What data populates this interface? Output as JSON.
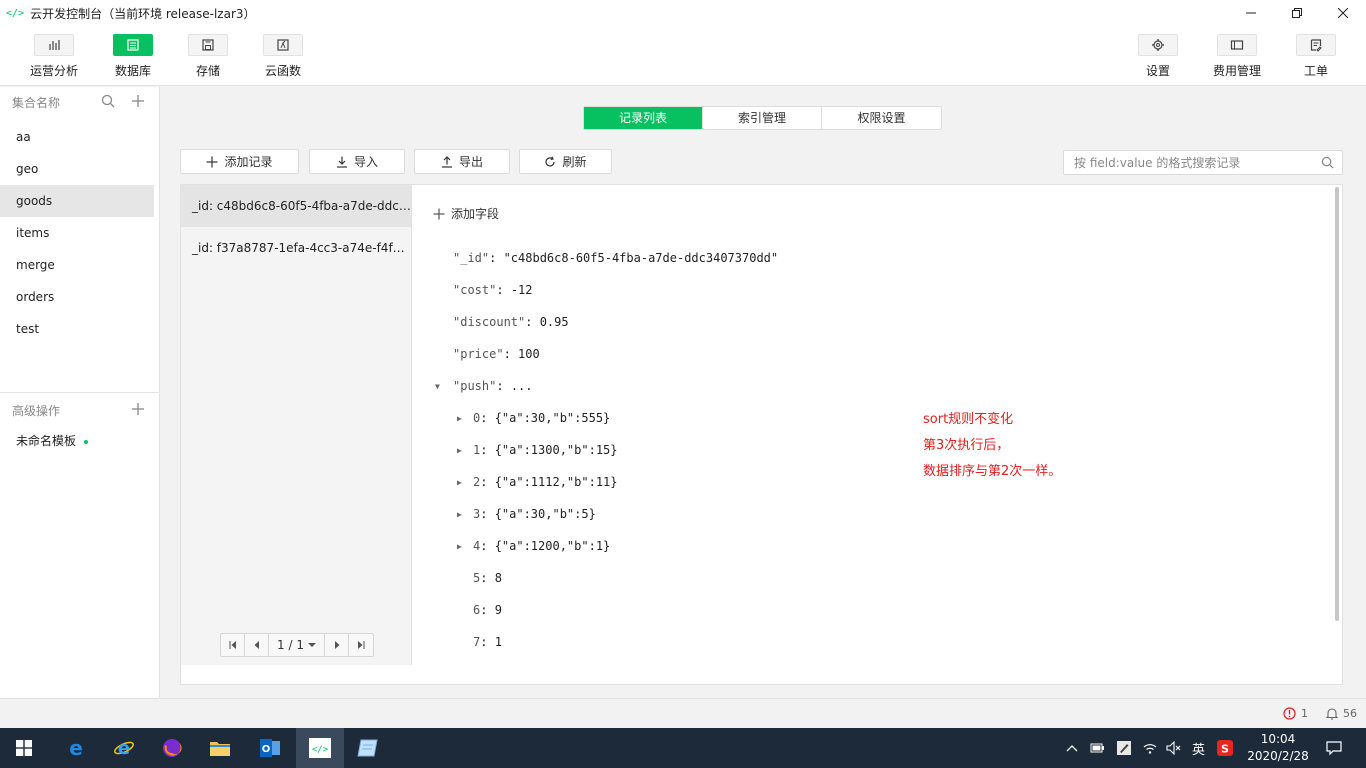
{
  "window": {
    "title": "云开发控制台（当前环境 release-lzar3）",
    "app_icon": "</>"
  },
  "toolbar": {
    "left": [
      {
        "label": "运营分析",
        "icon": "chart-icon"
      },
      {
        "label": "数据库",
        "icon": "database-icon",
        "active": true
      },
      {
        "label": "存储",
        "icon": "storage-icon"
      },
      {
        "label": "云函数",
        "icon": "function-icon"
      }
    ],
    "right": [
      {
        "label": "设置",
        "icon": "gear-icon"
      },
      {
        "label": "费用管理",
        "icon": "billing-icon"
      },
      {
        "label": "工单",
        "icon": "ticket-icon"
      }
    ]
  },
  "sidebar": {
    "header": "集合名称",
    "collections": [
      "aa",
      "geo",
      "goods",
      "items",
      "merge",
      "orders",
      "test"
    ],
    "selected": "goods",
    "advanced_header": "高级操作",
    "template": "未命名模板"
  },
  "tabs": [
    {
      "label": "记录列表",
      "active": true
    },
    {
      "label": "索引管理"
    },
    {
      "label": "权限设置"
    }
  ],
  "actions": {
    "add": "添加记录",
    "import": "导入",
    "export": "导出",
    "refresh": "刷新"
  },
  "search": {
    "placeholder": "按 field:value 的格式搜索记录"
  },
  "records": [
    "_id: c48bd6c8-60f5-4fba-a7de-ddc3407370dd",
    "_id: f37a8787-1efa-4cc3-a74e-f4fa..."
  ],
  "pagination": {
    "label": "1 / 1"
  },
  "detail": {
    "add_field": "添加字段",
    "fields": [
      {
        "key": "\"_id\"",
        "value": "\"c48bd6c8-60f5-4fba-a7de-ddc3407370dd\""
      },
      {
        "key": "\"cost\"",
        "value": "-12"
      },
      {
        "key": "\"discount\"",
        "value": "0.95"
      },
      {
        "key": "\"price\"",
        "value": "100"
      },
      {
        "key": "\"push\"",
        "value": "..."
      }
    ],
    "push_items": [
      {
        "key": "0",
        "value": "{\"a\":30,\"b\":555}"
      },
      {
        "key": "1",
        "value": "{\"a\":1300,\"b\":15}"
      },
      {
        "key": "2",
        "value": "{\"a\":1112,\"b\":11}"
      },
      {
        "key": "3",
        "value": "{\"a\":30,\"b\":5}"
      },
      {
        "key": "4",
        "value": "{\"a\":1200,\"b\":1}"
      },
      {
        "key": "5",
        "value": "8"
      },
      {
        "key": "6",
        "value": "9"
      },
      {
        "key": "7",
        "value": "1"
      }
    ]
  },
  "annotation": [
    "sort规则不变化",
    "第3次执行后，",
    "数据排序与第2次一样。"
  ],
  "statusbar": {
    "errors": "1",
    "notifications": "56"
  },
  "taskbar": {
    "tray_lang": "英",
    "time": "10:04",
    "date": "2020/2/28"
  },
  "colors": {
    "accent": "#07c160",
    "annotation": "#e02020"
  }
}
